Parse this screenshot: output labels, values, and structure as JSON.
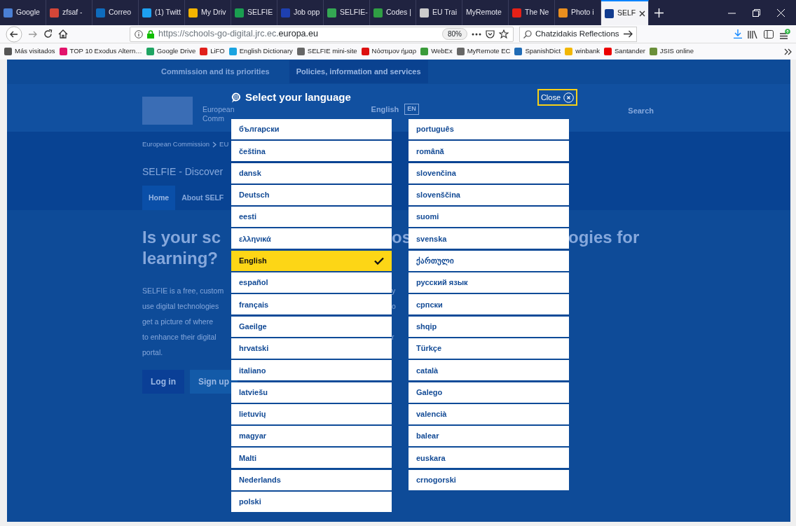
{
  "browser": {
    "tabs": [
      {
        "label": "Google",
        "selected": false,
        "color": "#4a7fd4"
      },
      {
        "label": "zfsaf - ",
        "selected": false,
        "color": "#d44638"
      },
      {
        "label": "Correo",
        "selected": false,
        "color": "#0f6cbd"
      },
      {
        "label": "(1) Twitt",
        "selected": false,
        "color": "#1da1f2"
      },
      {
        "label": "My Driv",
        "selected": false,
        "color": "#f4b400"
      },
      {
        "label": "SELFIE",
        "selected": false,
        "color": "#1a9e50"
      },
      {
        "label": "Job opp",
        "selected": false,
        "color": "#1e40b0"
      },
      {
        "label": "SELFIE-",
        "selected": false,
        "color": "#34a853"
      },
      {
        "label": "Codes |",
        "selected": false,
        "color": "#2f9e44"
      },
      {
        "label": "EU Trai",
        "selected": false,
        "color": "#cccccc"
      },
      {
        "label": "MyRemote",
        "selected": false
      },
      {
        "label": "The Ne",
        "selected": false,
        "color": "#e62117"
      },
      {
        "label": "Photo i",
        "selected": false,
        "color": "#ea8f1f"
      },
      {
        "label": "SELF",
        "selected": true,
        "color": "#123c8f"
      }
    ],
    "url_scheme_host": "https://schools-go-digital.jrc.ec.",
    "url_domain": "europa.eu",
    "zoom": "80%",
    "search_value": "Chatzidakis Reflections",
    "bookmarks": [
      {
        "label": "Más visitados",
        "color": "#555555"
      },
      {
        "label": "TOP 10 Exodus Altern…",
        "color": "#e2126b"
      },
      {
        "label": "Google Drive",
        "color": "#1fa463"
      },
      {
        "label": "LiFO",
        "color": "#e0201c"
      },
      {
        "label": "English Dictionary",
        "color": "#1aa3e0"
      },
      {
        "label": "SELFIE mini-site",
        "color": "#666666"
      },
      {
        "label": "Νόστιμον ήμαρ",
        "color": "#dd1111"
      },
      {
        "label": "WebEx",
        "color": "#3a9b3a"
      },
      {
        "label": "MyRemote EC",
        "color": "#666666"
      },
      {
        "label": "SpanishDict",
        "color": "#1f6bb5"
      },
      {
        "label": "winbank",
        "color": "#f2b705"
      },
      {
        "label": "Santander",
        "color": "#ec0000"
      },
      {
        "label": "JSIS online",
        "color": "#6a8f3a"
      }
    ]
  },
  "background_page": {
    "top_nav": [
      {
        "label": "Commission and its priorities",
        "selected": false
      },
      {
        "label": "Policies, information and services",
        "selected": true
      }
    ],
    "site_name_lines": [
      "European",
      "Comm"
    ],
    "language": "English",
    "language_code": "EN",
    "search": "Search",
    "breadcrumb": [
      "European Commission",
      "EU"
    ],
    "site_title": "SELFIE - Discover",
    "nav": [
      {
        "label": "Home",
        "selected": true
      },
      {
        "label": "About SELF",
        "selected": false
      }
    ],
    "heading_lines": [
      {
        "left": "Is your sc",
        "middle": "os",
        "right": "ogies for"
      },
      {
        "left": "learning?"
      }
    ],
    "paragraph_lines": [
      {
        "left": "SELFIE is a free, custom",
        "middle": "y"
      },
      {
        "left": "use digital technologies",
        "middle": "o"
      },
      {
        "left": "get a picture of where"
      },
      {
        "left": "to enhance their digital",
        "middle": "r"
      },
      {
        "left": "portal."
      }
    ],
    "buttons": [
      "Log in",
      "Sign up"
    ]
  },
  "dialog": {
    "title": "Select your language",
    "close": "Close",
    "columns": [
      [
        {
          "label": "български",
          "selected": false
        },
        {
          "label": "čeština",
          "selected": false
        },
        {
          "label": "dansk",
          "selected": false
        },
        {
          "label": "Deutsch",
          "selected": false
        },
        {
          "label": "eesti",
          "selected": false
        },
        {
          "label": "ελληνικά",
          "selected": false
        },
        {
          "label": "English",
          "selected": true
        },
        {
          "label": "español",
          "selected": false
        },
        {
          "label": "français",
          "selected": false
        },
        {
          "label": "Gaeilge",
          "selected": false
        },
        {
          "label": "hrvatski",
          "selected": false
        },
        {
          "label": "italiano",
          "selected": false
        },
        {
          "label": "latviešu",
          "selected": false
        },
        {
          "label": "lietuvių",
          "selected": false
        },
        {
          "label": "magyar",
          "selected": false
        },
        {
          "label": "Malti",
          "selected": false
        },
        {
          "label": "Nederlands",
          "selected": false
        },
        {
          "label": "polski",
          "selected": false
        }
      ],
      [
        {
          "label": "português",
          "selected": false
        },
        {
          "label": "română",
          "selected": false
        },
        {
          "label": "slovenčina",
          "selected": false
        },
        {
          "label": "slovenščina",
          "selected": false
        },
        {
          "label": "suomi",
          "selected": false
        },
        {
          "label": "svenska",
          "selected": false
        },
        {
          "label": "ქართული",
          "selected": false
        },
        {
          "label": "русский язык",
          "selected": false
        },
        {
          "label": "српски",
          "selected": false
        },
        {
          "label": "shqip",
          "selected": false
        },
        {
          "label": "Türkçe",
          "selected": false
        },
        {
          "label": "català",
          "selected": false
        },
        {
          "label": "Galego",
          "selected": false
        },
        {
          "label": "valencià",
          "selected": false
        },
        {
          "label": "balear",
          "selected": false
        },
        {
          "label": "euskara",
          "selected": false
        },
        {
          "label": "crnogorski",
          "selected": false
        }
      ]
    ]
  }
}
